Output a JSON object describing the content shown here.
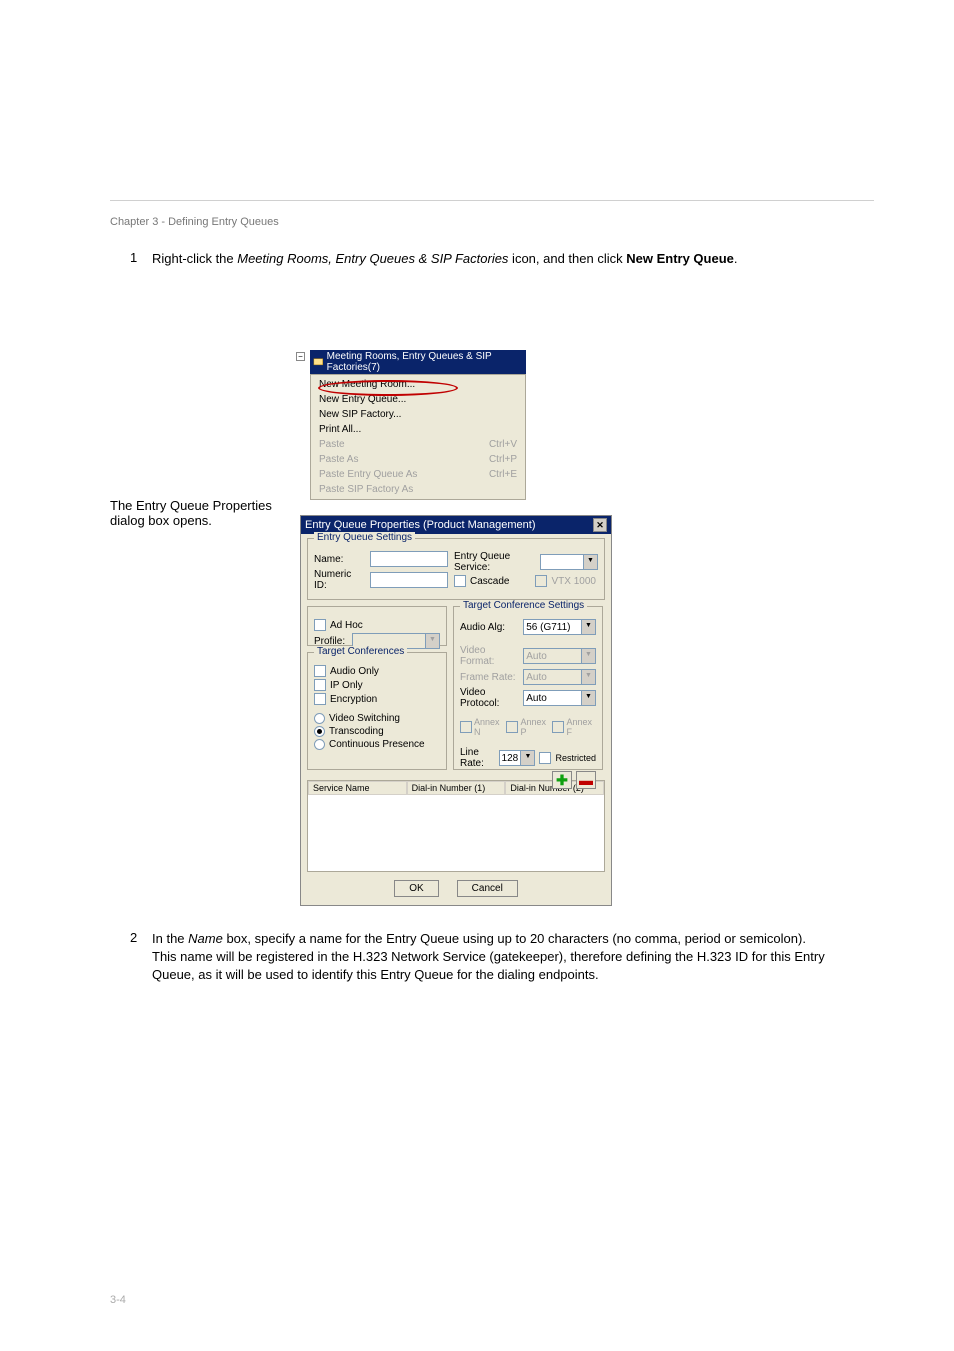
{
  "page": {
    "chapterTitle": "Chapter 3 - Defining Entry Queues",
    "pageNumber": "3-4"
  },
  "step1": {
    "number": "1",
    "prefix": "Right-click the ",
    "italic": "Meeting Rooms, Entry Queues & SIP Factories",
    "middle": " icon, and then click ",
    "bold": "New Entry Queue",
    "suffix": "."
  },
  "contextMenu": {
    "title": "Meeting Rooms, Entry Queues & SIP Factories(7)",
    "items": [
      {
        "label": "New Meeting Room...",
        "shortcut": "",
        "enabled": true
      },
      {
        "label": "New Entry Queue...",
        "shortcut": "",
        "enabled": true
      },
      {
        "label": "New SIP Factory...",
        "shortcut": "",
        "enabled": true
      },
      {
        "label": "Print All...",
        "shortcut": "",
        "enabled": true
      },
      {
        "label": "Paste",
        "shortcut": "Ctrl+V",
        "enabled": false
      },
      {
        "label": "Paste As",
        "shortcut": "Ctrl+P",
        "enabled": false
      },
      {
        "label": "Paste Entry Queue As",
        "shortcut": "Ctrl+E",
        "enabled": false
      },
      {
        "label": "Paste SIP Factory As",
        "shortcut": "",
        "enabled": false
      }
    ]
  },
  "step2pre": "The Entry Queue Properties dialog box opens.",
  "dialog": {
    "title": "Entry Queue Properties (Product Management)",
    "groups": {
      "settings": "Entry Queue Settings",
      "target": "Target Conference Settings",
      "confs": "Target Conferences"
    },
    "labels": {
      "name": "Name:",
      "numericId": "Numeric ID:",
      "eqService": "Entry Queue Service:",
      "cascade": "Cascade",
      "vtx1000": "VTX 1000",
      "adhoc": "Ad Hoc",
      "profile": "Profile:",
      "audioOnly": "Audio Only",
      "ipOnly": "IP Only",
      "encryption": "Encryption",
      "videoSwitching": "Video Switching",
      "transcoding": "Transcoding",
      "continuousPresence": "Continuous Presence",
      "audioAlg": "Audio Alg:",
      "videoFormat": "Video Format:",
      "frameRate": "Frame Rate:",
      "videoProtocol": "Video Protocol:",
      "annexN": "Annex N",
      "annexP": "Annex P",
      "annexF": "Annex F",
      "lineRate": "Line Rate:",
      "restricted": "Restricted",
      "ok": "OK",
      "cancel": "Cancel"
    },
    "values": {
      "audioAlg": "56 (G711)",
      "videoFormat": "Auto",
      "frameRate": "Auto",
      "videoProtocol": "Auto",
      "lineRate": "128"
    },
    "tableHeaders": {
      "serviceName": "Service Name",
      "dialIn1": "Dial-in Number (1)",
      "dialIn2": "Dial-in Number (2)"
    }
  },
  "step3": {
    "number": "2",
    "prefix": "In the ",
    "italic": "Name",
    "middle": " box, specify a name for the Entry Queue using up to 20 characters (no comma, period or semicolon). This name will be registered in the H.323 Network Service (gatekeeper), therefore defining the H.323 ID for this Entry Queue, as it will be used to identify this Entry Queue for the dialing endpoints."
  }
}
